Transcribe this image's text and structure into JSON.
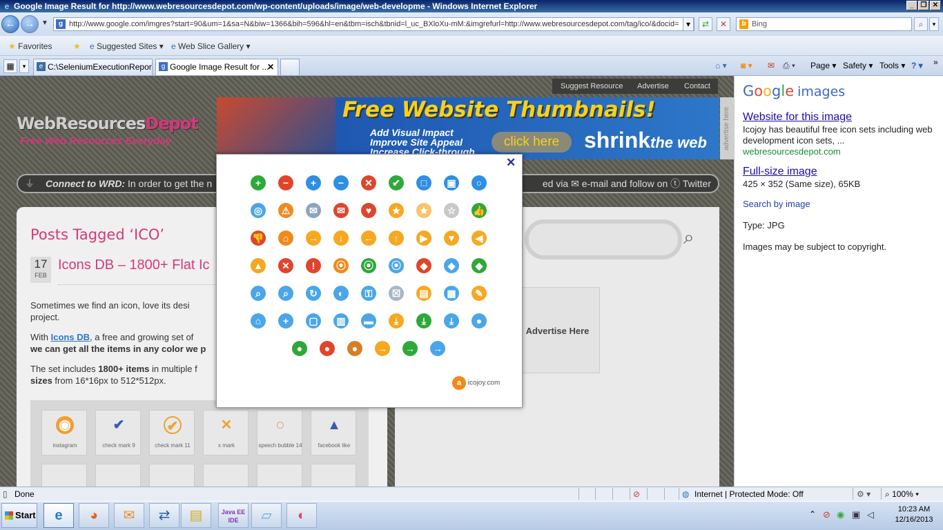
{
  "window": {
    "title": "Google Image Result for http://www.webresourcesdepot.com/wp-content/uploads/image/web-developme - Windows Internet Explorer"
  },
  "nav": {
    "address": "http://www.google.com/imgres?start=90&um=1&sa=N&biw=1366&bih=596&hl=en&tbm=isch&tbnid=l_uc_BXloXu-mM:&imgrefurl=http://www.webresourcesdepot.com/tag/ico/&docid=",
    "search_placeholder": "Bing"
  },
  "favorites": {
    "favorites_label": "Favorites",
    "suggested_sites": "Suggested Sites",
    "web_slice_gallery": "Web Slice Gallery"
  },
  "tabs": [
    {
      "label": "C:\\SeleniumExecutionReport..."
    },
    {
      "label": "Google Image Result for ..."
    }
  ],
  "commandbar": {
    "page": "Page",
    "safety": "Safety",
    "tools": "Tools"
  },
  "site": {
    "topnav": [
      "Suggest Resource",
      "Advertise",
      "Contact"
    ],
    "logo_main_a": "WebResources",
    "logo_main_b": "Depot",
    "logo_tagline": "Free Web Resources Everyday",
    "banner": {
      "headline": "Free Website Thumbnails!",
      "bullets": [
        "Add Visual Impact",
        "Improve Site Appeal",
        "Increase Click-through"
      ],
      "cta": "click here",
      "brand_a": "shrink",
      "brand_b": "the web"
    },
    "advertise_vertical": "advertise here",
    "connect_label": "Connect to WRD:",
    "connect_text": "In order to get the n",
    "connect_right": "ed via ✉ e-mail and follow on ⓣ Twitter",
    "posts_tagged": "Posts Tagged ‘ICO’",
    "date_day": "17",
    "date_month": "FEB",
    "entry_title": "Icons DB – 1800+ Flat Ic",
    "para1_line1": "Sometimes we find an icon, love its desi",
    "para1_line2": "project.",
    "para2_a": "With ",
    "para2_link": "Icons DB",
    "para2_b": ", a free and growing set of",
    "para2_line2": "we can get all the items in any color we p",
    "para3_a": "The set includes ",
    "para3_b": "1800+ items",
    "para3_c": " in multiple f",
    "para3_line2_b": "sizes",
    "para3_line2_c": " from 16*16px to 512*512px.",
    "grid_labels": [
      "instagram",
      "check mark 9",
      "check mark 11",
      "x mark",
      "speech bubble 14",
      "facebook like"
    ],
    "advertise_here": "Advertise Here"
  },
  "popup": {
    "close": "✕",
    "credit": "icojoy.com",
    "icons": [
      {
        "name": "add-icon",
        "glyph": "+",
        "color": "#2fa83a"
      },
      {
        "name": "remove-icon",
        "glyph": "−",
        "color": "#e0452c"
      },
      {
        "name": "add-square-icon",
        "glyph": "+",
        "color": "#2f8fe0"
      },
      {
        "name": "minus-square-icon",
        "glyph": "−",
        "color": "#2f8fe0"
      },
      {
        "name": "close-circle-icon",
        "glyph": "✕",
        "color": "#e0452c"
      },
      {
        "name": "check-circle-icon",
        "glyph": "✔",
        "color": "#2fa83a"
      },
      {
        "name": "stop-square-icon",
        "glyph": "□",
        "color": "#2f8fe0"
      },
      {
        "name": "stop-square-alt-icon",
        "glyph": "▣",
        "color": "#2f8fe0"
      },
      {
        "name": "ring-icon",
        "glyph": "○",
        "color": "#2f8fe0"
      },
      {
        "name": "target-icon",
        "glyph": "◎",
        "color": "#4aa6e8"
      },
      {
        "name": "warning-outline-icon",
        "glyph": "⚠",
        "color": "#f08a1c"
      },
      {
        "name": "mail-grey-icon",
        "glyph": "✉",
        "color": "#8ea4bd"
      },
      {
        "name": "mail-red-icon",
        "glyph": "✉",
        "color": "#e0452c"
      },
      {
        "name": "heart-icon",
        "glyph": "♥",
        "color": "#e0452c"
      },
      {
        "name": "star-full-icon",
        "glyph": "★",
        "color": "#f6a821"
      },
      {
        "name": "star-half-icon",
        "glyph": "★",
        "color": "#f8c36a"
      },
      {
        "name": "star-empty-icon",
        "glyph": "☆",
        "color": "#c8c8c8"
      },
      {
        "name": "thumbs-up-icon",
        "glyph": "👍",
        "color": "#2fa83a"
      },
      {
        "name": "thumbs-down-icon",
        "glyph": "👎",
        "color": "#e0452c"
      },
      {
        "name": "home-icon",
        "glyph": "⌂",
        "color": "#f08a1c"
      },
      {
        "name": "arrow-right-circle-icon",
        "glyph": "→",
        "color": "#f6a821"
      },
      {
        "name": "arrow-down-circle-icon",
        "glyph": "↓",
        "color": "#f6a821"
      },
      {
        "name": "arrow-left-circle-icon",
        "glyph": "←",
        "color": "#f6a821"
      },
      {
        "name": "arrow-up-circle-icon",
        "glyph": "↑",
        "color": "#f6a821"
      },
      {
        "name": "triangle-right-icon",
        "glyph": "▶",
        "color": "#f6a821"
      },
      {
        "name": "triangle-down-icon",
        "glyph": "▼",
        "color": "#f6a821"
      },
      {
        "name": "triangle-left-icon",
        "glyph": "◀",
        "color": "#f6a821"
      },
      {
        "name": "triangle-up-icon",
        "glyph": "▲",
        "color": "#f6a821"
      },
      {
        "name": "close-red-square-icon",
        "glyph": "✕",
        "color": "#e0452c"
      },
      {
        "name": "warning-red-icon",
        "glyph": "!",
        "color": "#e0452c"
      },
      {
        "name": "rss-orange-icon",
        "glyph": "⦿",
        "color": "#f08a1c"
      },
      {
        "name": "rss-green-icon",
        "glyph": "⦿",
        "color": "#2fa83a"
      },
      {
        "name": "rss-blue-icon",
        "glyph": "⦿",
        "color": "#4aa6e8"
      },
      {
        "name": "tag-red-icon",
        "glyph": "◆",
        "color": "#e0452c"
      },
      {
        "name": "tag-blue-icon",
        "glyph": "◆",
        "color": "#4aa6e8"
      },
      {
        "name": "tag-green-icon",
        "glyph": "◆",
        "color": "#2fa83a"
      },
      {
        "name": "search-square-icon",
        "glyph": "⌕",
        "color": "#4aa6e8"
      },
      {
        "name": "search-icon",
        "glyph": "⌕",
        "color": "#4aa6e8"
      },
      {
        "name": "refresh-icon",
        "glyph": "↻",
        "color": "#4aa6e8"
      },
      {
        "name": "globe-icon",
        "glyph": "◐",
        "color": "#4aa6e8"
      },
      {
        "name": "key-icon",
        "glyph": "⚿",
        "color": "#4aa6e8"
      },
      {
        "name": "lock-icon",
        "glyph": "☒",
        "color": "#a9b6c4"
      },
      {
        "name": "folder-icon",
        "glyph": "▤",
        "color": "#f6a821"
      },
      {
        "name": "calendar-icon",
        "glyph": "▦",
        "color": "#4aa6e8"
      },
      {
        "name": "pencil-icon",
        "glyph": "✎",
        "color": "#f6a821"
      },
      {
        "name": "cart-icon",
        "glyph": "⌂",
        "color": "#4aa6e8"
      },
      {
        "name": "cart-add-icon",
        "glyph": "+",
        "color": "#4aa6e8"
      },
      {
        "name": "cart-square-icon",
        "glyph": "▢",
        "color": "#4aa6e8"
      },
      {
        "name": "trash-icon",
        "glyph": "▥",
        "color": "#4aa6e8"
      },
      {
        "name": "speech-bubble-icon",
        "glyph": "▬",
        "color": "#4aa6e8"
      },
      {
        "name": "download-orange-icon",
        "glyph": "⤓",
        "color": "#f6a821"
      },
      {
        "name": "download-green-icon",
        "glyph": "⤓",
        "color": "#2fa83a"
      },
      {
        "name": "download-blue-icon",
        "glyph": "⤓",
        "color": "#4aa6e8"
      },
      {
        "name": "user-blue-icon",
        "glyph": "●",
        "color": "#4aa6e8"
      },
      {
        "name": "user-green-icon",
        "glyph": "●",
        "color": "#2fa83a"
      },
      {
        "name": "user-female-icon",
        "glyph": "●",
        "color": "#e0452c"
      },
      {
        "name": "users-group-icon",
        "glyph": "●",
        "color": "#d87d2a"
      },
      {
        "name": "arrow-right-orange-icon",
        "glyph": "→",
        "color": "#f6a821"
      },
      {
        "name": "arrow-right-green-icon",
        "glyph": "→",
        "color": "#2fa83a"
      },
      {
        "name": "arrow-right-blue-icon",
        "glyph": "→",
        "color": "#4aa6e8"
      }
    ]
  },
  "rightpanel": {
    "google_logo": "Google",
    "images_label": "images",
    "website_link": "Website for this image",
    "description": "Icojoy has beautiful free icon sets including web development icon sets, ...",
    "domain": "webresourcesdepot.com",
    "fullsize_link": "Full-size image",
    "fullsize_info": "425 × 352 (Same size), 65KB",
    "search_by_image": "Search by image",
    "type_label": "Type:  JPG",
    "copyright": "Images may be subject to copyright."
  },
  "status": {
    "done": "Done",
    "zone": "Internet | Protected Mode: Off",
    "zoom": "100%"
  },
  "taskbar": {
    "start": "Start",
    "time": "10:23 AM",
    "date": "12/16/2013"
  }
}
